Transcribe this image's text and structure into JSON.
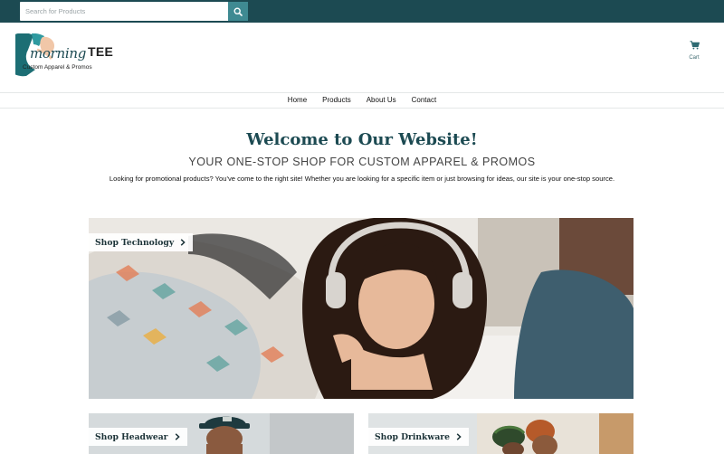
{
  "search": {
    "placeholder": "Search for Products"
  },
  "brand": {
    "name_script": "morning",
    "name_bold": "TEE",
    "tagline": "Custom Apparel & Promos",
    "primary_color": "#1c4a52",
    "accent_color": "#3f8a92"
  },
  "cart": {
    "label": "Cart",
    "icon": "cart-icon"
  },
  "nav": {
    "items": [
      "Home",
      "Products",
      "About Us",
      "Contact"
    ]
  },
  "hero": {
    "title": "Welcome to Our Website!",
    "subtitle": "YOUR ONE-STOP SHOP FOR CUSTOM APPAREL & PROMOS",
    "intro": "Looking for promotional products? You've come to the right site! Whether you are looking for a specific item or just browsing for ideas, our site is your one-stop source."
  },
  "tiles": [
    {
      "label": "Shop Technology",
      "icon": "chevron-right-icon"
    },
    {
      "label": "Shop Headwear",
      "icon": "chevron-right-icon"
    },
    {
      "label": "Shop Drinkware",
      "icon": "chevron-right-icon"
    }
  ]
}
